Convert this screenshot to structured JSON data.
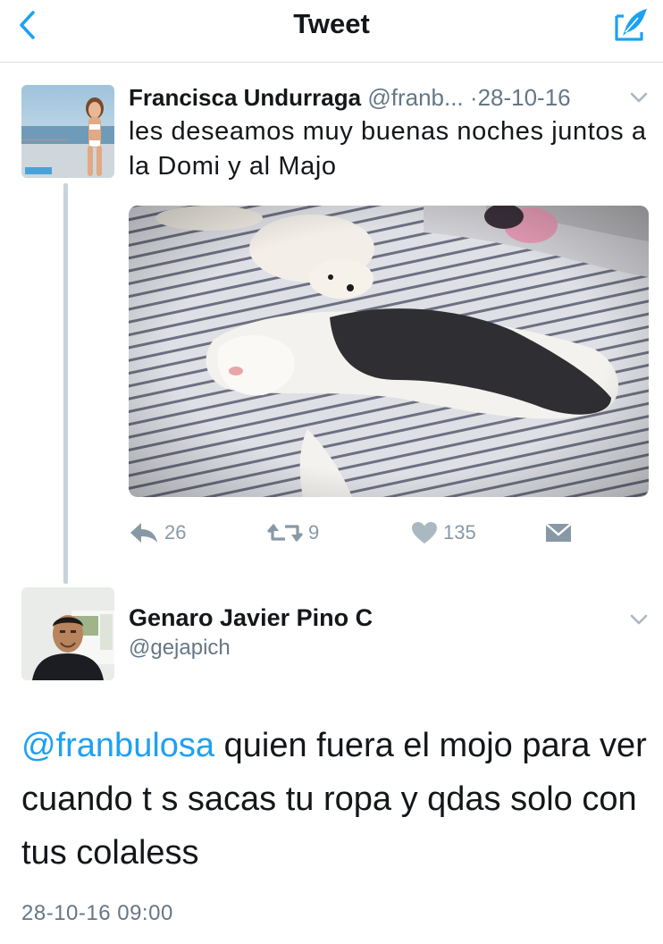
{
  "header": {
    "title": "Tweet",
    "back_icon": "chevron-left-icon",
    "compose_icon": "compose-feather-icon",
    "accent": "#1da1f2"
  },
  "tweet1": {
    "name": "Francisca Undurraga",
    "handle": "@franb...",
    "separator": "·",
    "date": "28-10-16",
    "text": "les deseamos muy buenas noches juntos a la Domi y al Majo",
    "actions": {
      "replies": "26",
      "retweets": "9",
      "likes": "135"
    }
  },
  "tweet2": {
    "name": "Genaro Javier Pino C",
    "handle": "@gejapich",
    "mention": "@franbulosa",
    "text": " quien fuera el mojo para ver cuando t s sacas tu ropa y qdas solo con tus colaless",
    "timestamp": "28-10-16 09:00"
  }
}
